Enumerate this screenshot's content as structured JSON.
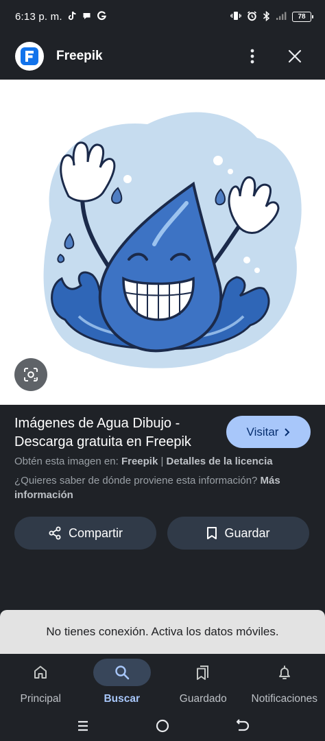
{
  "status_bar": {
    "time": "6:13 p. m.",
    "notification_icons": [
      "tiktok-icon",
      "chat-bubble-icon",
      "google-icon"
    ],
    "right_icons": [
      "vibrate-icon",
      "alarm-icon",
      "bluetooth-icon",
      "signal-icon"
    ],
    "battery": "78"
  },
  "header": {
    "site_name": "Freepik",
    "logo_letter": "F",
    "brand_color": "#1273eb"
  },
  "result": {
    "title": "Imágenes de Agua Dibujo - Descarga gratuita en Freepik",
    "visit_label": "Visitar",
    "source_prefix": "Obtén esta imagen en:",
    "source_name": "Freepik",
    "separator": "|",
    "license_link": "Detalles de la licencia",
    "info_question": "¿Quieres saber de dónde proviene esta información?",
    "info_link": "Más información"
  },
  "actions": {
    "share_label": "Compartir",
    "save_label": "Guardar"
  },
  "snackbar": {
    "message": "No tienes conexión. Activa los datos móviles."
  },
  "bottom_nav": {
    "items": [
      {
        "label": "Principal",
        "icon": "home-icon",
        "active": false
      },
      {
        "label": "Buscar",
        "icon": "search-icon",
        "active": true
      },
      {
        "label": "Guardado",
        "icon": "collections-icon",
        "active": false
      },
      {
        "label": "Notificaciones",
        "icon": "bell-icon",
        "active": false
      }
    ]
  },
  "colors": {
    "accent": "#a8c7fa",
    "background": "#1f2227",
    "button_bg": "#303a48",
    "snackbar_bg": "#e3e3e3"
  }
}
